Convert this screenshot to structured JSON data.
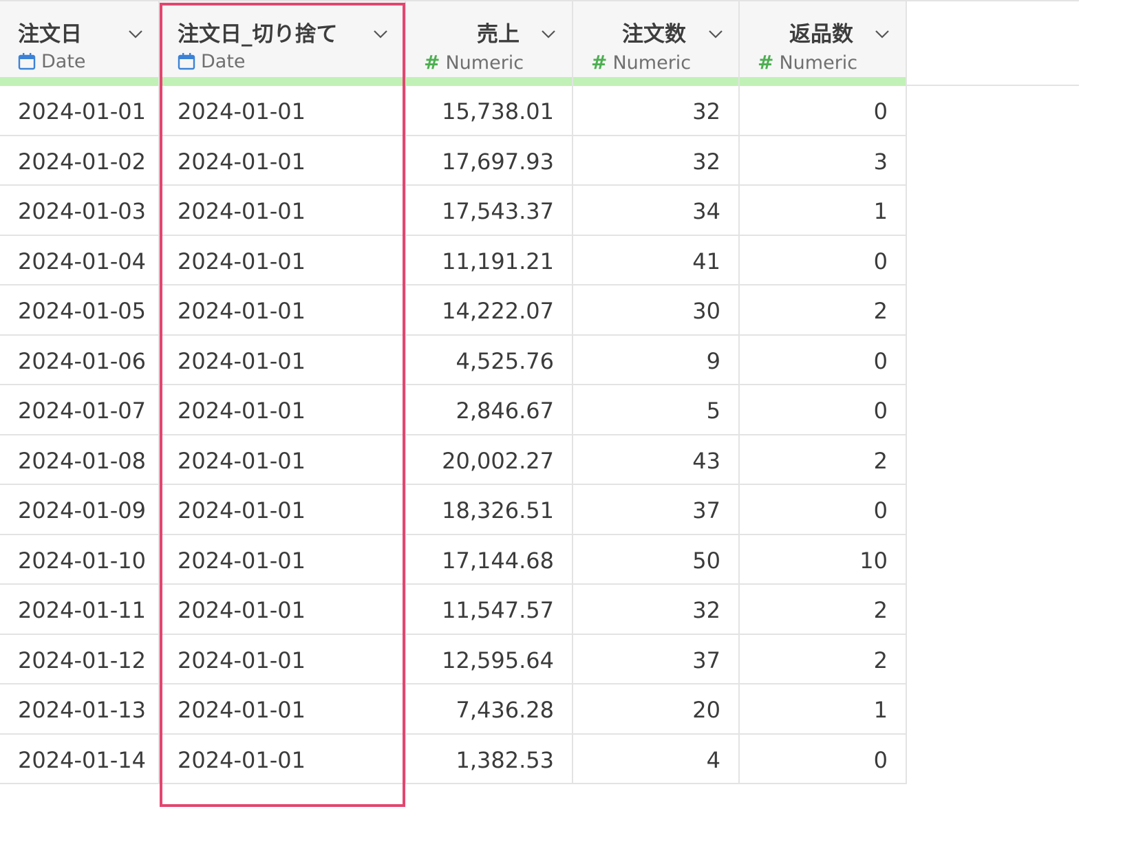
{
  "colors": {
    "highlight": "#e2466f",
    "quality_bar": "#c1f1b6",
    "date_icon": "#3b82d6",
    "numeric_icon": "#4caf50"
  },
  "columns": [
    {
      "name": "注文日",
      "type": "Date",
      "icon": "calendar-icon"
    },
    {
      "name": "注文日_切り捨て",
      "type": "Date",
      "icon": "calendar-icon"
    },
    {
      "name": "売上",
      "type": "Numeric",
      "icon": "hash-icon"
    },
    {
      "name": "注文数",
      "type": "Numeric",
      "icon": "hash-icon"
    },
    {
      "name": "返品数",
      "type": "Numeric",
      "icon": "hash-icon"
    }
  ],
  "rows": [
    [
      "2024-01-01",
      "2024-01-01",
      "15,738.01",
      "32",
      "0"
    ],
    [
      "2024-01-02",
      "2024-01-01",
      "17,697.93",
      "32",
      "3"
    ],
    [
      "2024-01-03",
      "2024-01-01",
      "17,543.37",
      "34",
      "1"
    ],
    [
      "2024-01-04",
      "2024-01-01",
      "11,191.21",
      "41",
      "0"
    ],
    [
      "2024-01-05",
      "2024-01-01",
      "14,222.07",
      "30",
      "2"
    ],
    [
      "2024-01-06",
      "2024-01-01",
      "4,525.76",
      "9",
      "0"
    ],
    [
      "2024-01-07",
      "2024-01-01",
      "2,846.67",
      "5",
      "0"
    ],
    [
      "2024-01-08",
      "2024-01-01",
      "20,002.27",
      "43",
      "2"
    ],
    [
      "2024-01-09",
      "2024-01-01",
      "18,326.51",
      "37",
      "0"
    ],
    [
      "2024-01-10",
      "2024-01-01",
      "17,144.68",
      "50",
      "10"
    ],
    [
      "2024-01-11",
      "2024-01-01",
      "11,547.57",
      "32",
      "2"
    ],
    [
      "2024-01-12",
      "2024-01-01",
      "12,595.64",
      "37",
      "2"
    ],
    [
      "2024-01-13",
      "2024-01-01",
      "7,436.28",
      "20",
      "1"
    ],
    [
      "2024-01-14",
      "2024-01-01",
      "1,382.53",
      "4",
      "0"
    ]
  ]
}
